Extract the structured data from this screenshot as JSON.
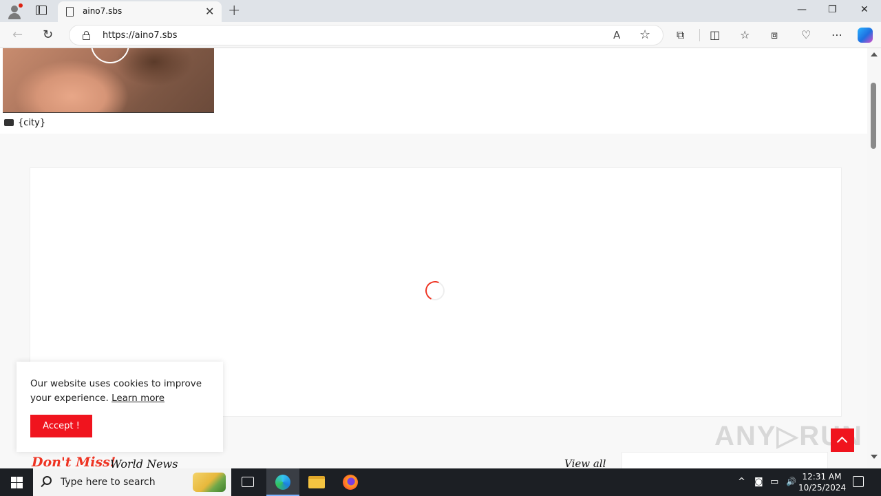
{
  "browser": {
    "tab_title": "aino7.sbs",
    "tab_close": "✕",
    "new_tab": "+",
    "url": "https://aino7.sbs",
    "window_controls": {
      "minimize": "—",
      "restore": "❐",
      "close": "✕"
    },
    "nav": {
      "back": "←",
      "refresh": "↻"
    },
    "url_icons": {
      "read_aloud": "A",
      "favorite": "☆"
    },
    "toolbar_icons": {
      "extensions": "⧉",
      "split": "◫",
      "favorites": "☆",
      "collections": "⧈",
      "performance": "♡",
      "more": "⋯"
    }
  },
  "page": {
    "city_label": "{city}",
    "section_title": "Don't Miss!",
    "section_subtitle": "World News",
    "view_all": "View all",
    "cookie": {
      "text": "Our website uses cookies to improve your experience.",
      "learn_more": "Learn more",
      "accept": "Accept !"
    },
    "watermark": "ANY▷RUN"
  },
  "taskbar": {
    "search_placeholder": "Type here to search",
    "tray_icons": {
      "chevron": "^",
      "meet": "◙",
      "network": "▭",
      "volume": "🔊"
    },
    "time": "12:31 AM",
    "date": "10/25/2024"
  },
  "colors": {
    "accent_red": "#f0141e",
    "taskbar": "#1c1f24"
  }
}
